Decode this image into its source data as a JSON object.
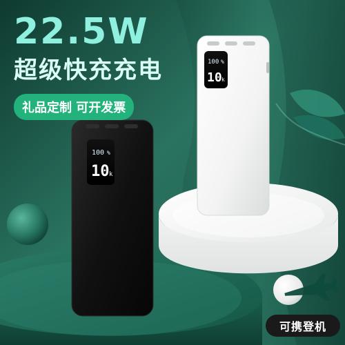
{
  "headline": {
    "power": "22.5W",
    "subtitle": "超级快充充电",
    "badge": "礼品定制 可开发票"
  },
  "devices": {
    "black": {
      "percent": "100",
      "percent_suffix": "%",
      "capacity": "10",
      "capacity_suffix": "k"
    },
    "white": {
      "percent": "100",
      "percent_suffix": "%",
      "capacity": "10",
      "capacity_suffix": "k"
    }
  },
  "footer": {
    "carry_label": "可携登机"
  },
  "colors": {
    "background_dark": "#1f5a4a",
    "background_light": "#2f7a66",
    "headline_accent": "#8ff0df",
    "badge": "#24b27c",
    "podium": "#1c5e4c",
    "white_podium": "#f4f5f4"
  },
  "icons": {
    "airplane": "airplane-icon"
  }
}
